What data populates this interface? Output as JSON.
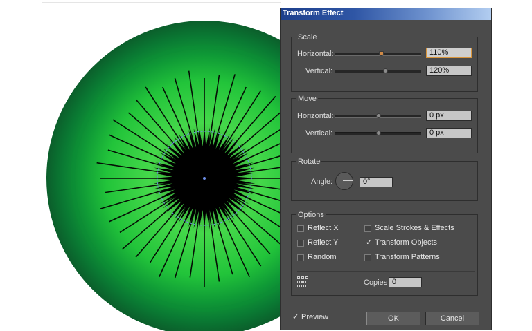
{
  "dialog": {
    "title": "Transform Effect",
    "scale": {
      "label": "Scale",
      "horizontal_label": "Horizontal:",
      "horizontal_value": "110%",
      "vertical_label": "Vertical:",
      "vertical_value": "120%"
    },
    "move": {
      "label": "Move",
      "horizontal_label": "Horizontal:",
      "horizontal_value": "0 px",
      "vertical_label": "Vertical:",
      "vertical_value": "0 px"
    },
    "rotate": {
      "label": "Rotate",
      "angle_label": "Angle:",
      "angle_value": "0°"
    },
    "options": {
      "label": "Options",
      "reflect_x": {
        "label": "Reflect X",
        "checked": false
      },
      "reflect_y": {
        "label": "Reflect Y",
        "checked": false
      },
      "random": {
        "label": "Random",
        "checked": false
      },
      "scale_strokes": {
        "label": "Scale Strokes & Effects",
        "checked": false
      },
      "transform_objects": {
        "label": "Transform Objects",
        "checked": true
      },
      "transform_patterns": {
        "label": "Transform Patterns",
        "checked": false
      },
      "copies_label": "Copies",
      "copies_value": "0",
      "reference_point_icon": "reference-point-grid-icon"
    },
    "preview": {
      "label": "Preview",
      "checked": true
    },
    "ok_label": "OK",
    "cancel_label": "Cancel",
    "check_glyph": "✓"
  },
  "canvas": {
    "iris_colors": {
      "outer": "#0b5e2b",
      "mid": "#18a63a",
      "inner": "#47e34a"
    },
    "pupil_color": "#000000",
    "selection_color": "#6d8fe8"
  }
}
